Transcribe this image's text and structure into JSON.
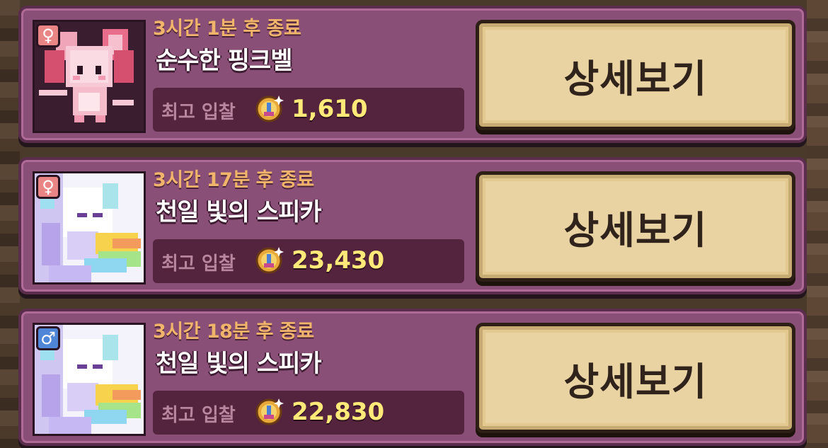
{
  "auctions": [
    {
      "gender_icon": "female",
      "gender_symbol": "♀",
      "time_left": "3시간 1분 후 종료",
      "name": "순수한 핑크벨",
      "bid_label": "최고 입찰",
      "bid_value": "1,610",
      "button_label": "상세보기",
      "pet_icon": "pink-bell-sprite"
    },
    {
      "gender_icon": "female",
      "gender_symbol": "♀",
      "time_left": "3시간 17분 후 종료",
      "name": "천일 빛의 스피카",
      "bid_label": "최고 입찰",
      "bid_value": "23,430",
      "button_label": "상세보기",
      "pet_icon": "spica-sprite"
    },
    {
      "gender_icon": "male",
      "gender_symbol": "♂",
      "time_left": "3시간 18분 후 종료",
      "name": "천일 빛의 스피카",
      "bid_label": "최고 입찰",
      "bid_value": "22,830",
      "button_label": "상세보기",
      "pet_icon": "spica-sprite"
    }
  ],
  "colors": {
    "card": "#8a4f77",
    "timer": "#f0b56a",
    "bid_value": "#ffe978",
    "button": "#e9d3a3"
  }
}
